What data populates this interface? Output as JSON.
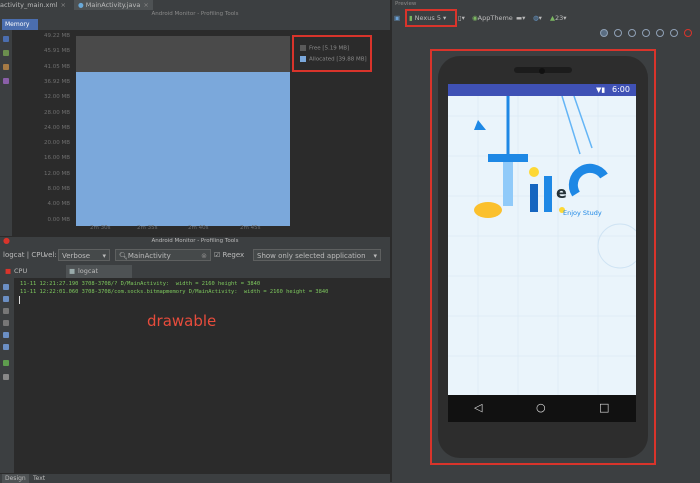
{
  "editor_tabs": [
    {
      "label": "activity_main.xml"
    },
    {
      "label": "MainActivity.java"
    }
  ],
  "monitor": {
    "title": "Android Monitor - Profiling Tools",
    "tab_label": "Memory"
  },
  "chart_data": {
    "type": "area",
    "title": "",
    "xlabel": "",
    "ylabel": "",
    "y_ticks": [
      "49.22 MB",
      "45.91 MB",
      "41.05 MB",
      "36.92 MB",
      "32.00 MB",
      "28.00 MB",
      "24.00 MB",
      "20.00 MB",
      "16.00 MB",
      "12.00 MB",
      "8.00 MB",
      "4.00 MB",
      "0.00 MB"
    ],
    "x_ticks": [
      "2m 30s",
      "2m 35s",
      "2m 40s",
      "2m 45s"
    ],
    "ylim": [
      0,
      49.22
    ],
    "series": [
      {
        "name": "Free [5.19 MB]",
        "value_mb": 5.19,
        "color": "#4a4a4a"
      },
      {
        "name": "Allocated [39.88 MB]",
        "value_mb": 39.88,
        "color": "#7ba8db"
      }
    ],
    "legend_position": "top-right"
  },
  "logcat": {
    "title": "Android Monitor - Profiling Tools",
    "device_label": "logcat | CPU",
    "level_label": "vel:",
    "level_value": "Verbose",
    "search_value": "MainActivity",
    "regex_label": "Regex",
    "filter_value": "Show only selected application",
    "sub_tabs": [
      {
        "label": "CPU"
      },
      {
        "label": "logcat"
      }
    ],
    "lines": [
      "11-11 12:21:27.190 3708-3708/? D/MainActivity:  width = 2160 height = 3840",
      "11-11 12:22:01.060 3708-3708/com.socks.bitmapmemory D/MainActivity:  width = 2160 height = 3840"
    ],
    "annotation": "drawable"
  },
  "bottom_tabs": [
    {
      "label": "Design"
    },
    {
      "label": "Text"
    }
  ],
  "preview": {
    "header": "Preview",
    "device": "Nexus 5",
    "theme": "AppTheme",
    "api": "23",
    "status_time": "6:00",
    "app_tagline": "Enjoy Study",
    "accent": "#d9342b"
  }
}
